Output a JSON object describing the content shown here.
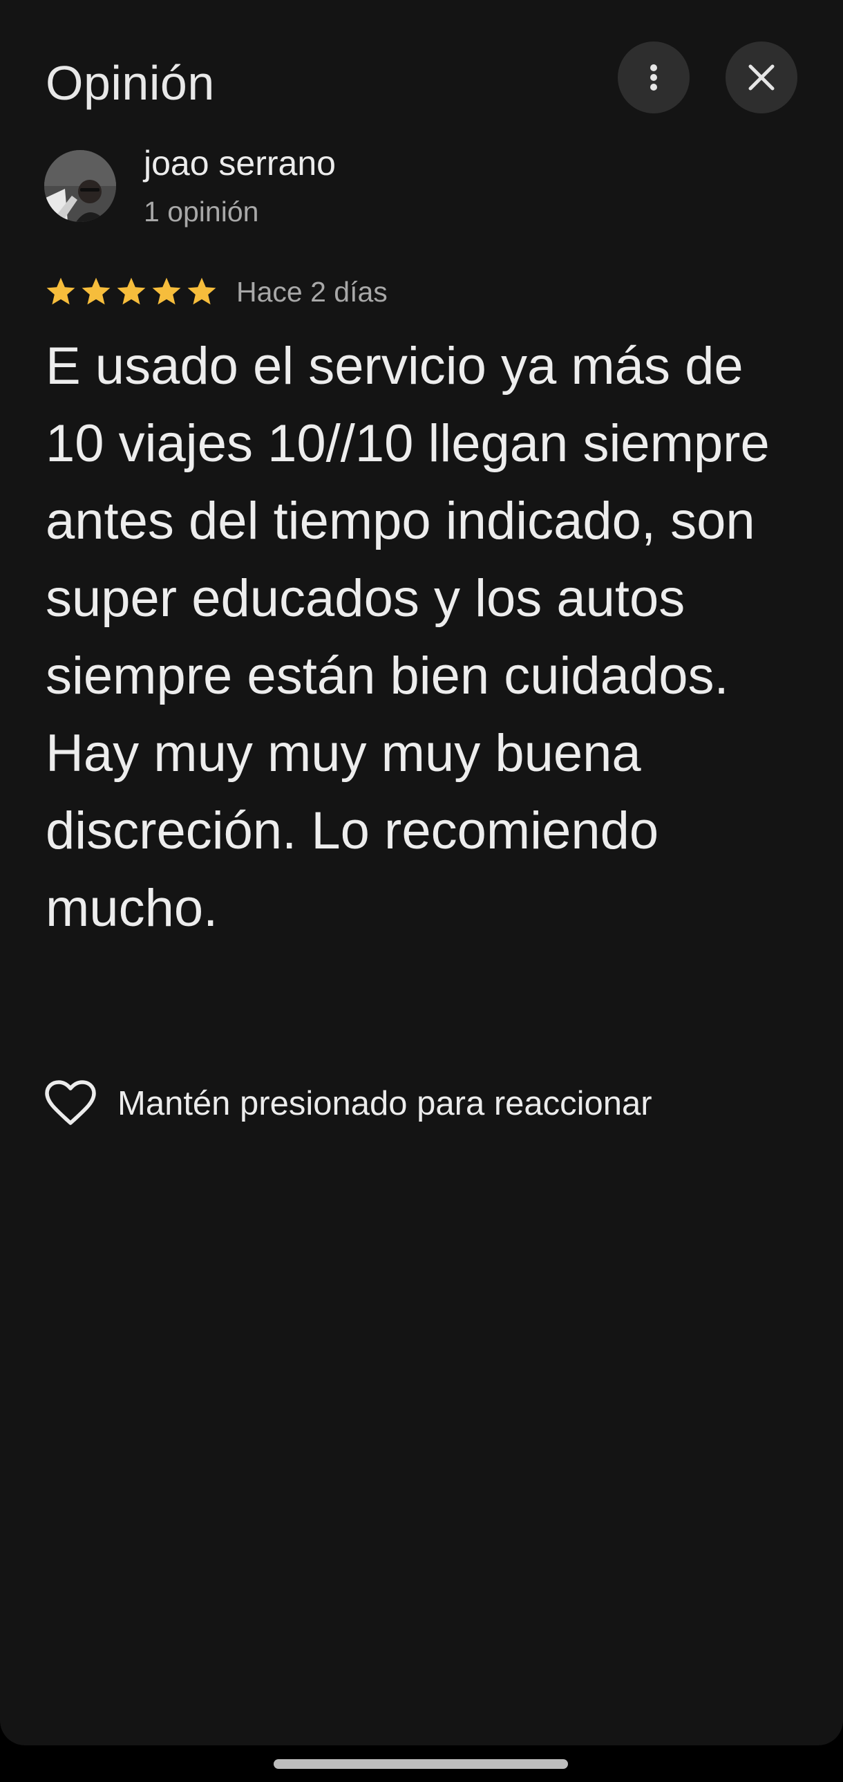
{
  "header": {
    "title": "Opinión",
    "more_icon": "more-vert-icon",
    "close_icon": "close-icon"
  },
  "author": {
    "name": "joao serrano",
    "review_count": "1 opinión"
  },
  "review": {
    "rating": 5,
    "rating_max": 5,
    "star_color": "#f6bd3c",
    "date": "Hace 2 días",
    "text": "E usado el servicio ya más de 10 viajes 10//10 llegan siempre antes del tiempo indicado, son super educados y los autos siempre están bien cuidados. Hay muy muy muy buena discreción. Lo recomiendo mucho."
  },
  "reaction": {
    "icon": "heart-outline-icon",
    "label": "Mantén presionado para reaccionar"
  },
  "colors": {
    "background": "#141414",
    "button_background": "#2e2e2e",
    "primary_text": "#ececec",
    "secondary_text": "#a8a8a8"
  }
}
